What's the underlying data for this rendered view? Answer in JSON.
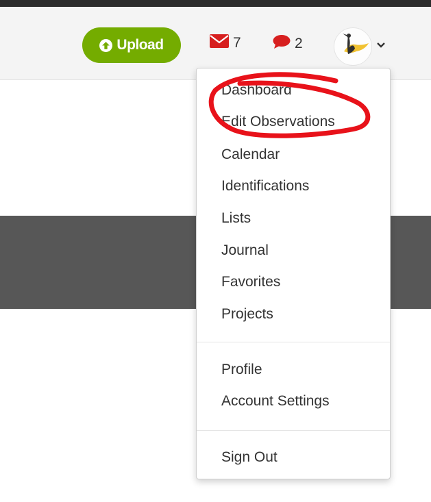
{
  "header": {
    "upload_label": "Upload",
    "messages_count": "7",
    "comments_count": "2",
    "colors": {
      "upload": "#74ac00",
      "counter_icons": "#d71f1f"
    }
  },
  "user_menu": {
    "items": [
      {
        "label": "Dashboard"
      },
      {
        "label": "Edit Observations"
      },
      {
        "label": "Calendar"
      },
      {
        "label": "Identifications"
      },
      {
        "label": "Lists"
      },
      {
        "label": "Journal"
      },
      {
        "label": "Favorites"
      },
      {
        "label": "Projects"
      },
      {
        "label": "Profile"
      },
      {
        "label": "Account Settings"
      },
      {
        "label": "Sign Out"
      }
    ]
  },
  "annotation": {
    "color": "#e8121a"
  }
}
